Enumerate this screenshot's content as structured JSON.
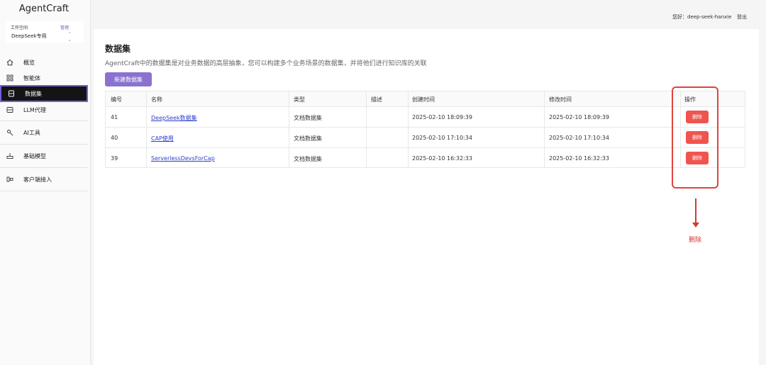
{
  "app": {
    "title": "AgentCraft"
  },
  "workspace": {
    "label": "工作空间",
    "manage": "管理",
    "value": "DeepSeek专用"
  },
  "sidebar": {
    "items": [
      {
        "label": "概览",
        "icon": "home-icon"
      },
      {
        "label": "智能体",
        "icon": "grid-icon"
      },
      {
        "label": "数据集",
        "icon": "dataset-icon",
        "active": true
      },
      {
        "label": "LLM代理",
        "icon": "server-icon"
      },
      {
        "label": "AI工具",
        "icon": "tool-icon"
      },
      {
        "label": "基础模型",
        "icon": "model-icon"
      },
      {
        "label": "客户端接入",
        "icon": "client-icon"
      }
    ]
  },
  "topbar": {
    "greeting": "您好：deep-seek-hanxie",
    "logout": "登出"
  },
  "page": {
    "title": "数据集",
    "description": "AgentCraft中的数据集是对业务数据的高层抽象，您可以构建多个业务场景的数据集，并将他们进行知识库的关联",
    "new_button": "新建数据集"
  },
  "table": {
    "headers": [
      "编号",
      "名称",
      "类型",
      "描述",
      "创建时间",
      "修改时间",
      "操作"
    ],
    "rows": [
      {
        "id": "41",
        "name": "DeepSeek数据集",
        "type": "文档数据集",
        "desc": "",
        "created": "2025-02-10 18:09:39",
        "modified": "2025-02-10 18:09:39",
        "action": "删除"
      },
      {
        "id": "40",
        "name": "CAP使用",
        "type": "文档数据集",
        "desc": "",
        "created": "2025-02-10 17:10:34",
        "modified": "2025-02-10 17:10:34",
        "action": "删除"
      },
      {
        "id": "39",
        "name": "ServerlessDevsForCap",
        "type": "文档数据集",
        "desc": "",
        "created": "2025-02-10 16:32:33",
        "modified": "2025-02-10 16:32:33",
        "action": "删除"
      }
    ]
  },
  "annotation": {
    "label": "删除"
  },
  "colors": {
    "accent": "#8a72cf",
    "danger": "#f0544f",
    "annotation": "#d23a30",
    "link": "#2d3fd1"
  }
}
